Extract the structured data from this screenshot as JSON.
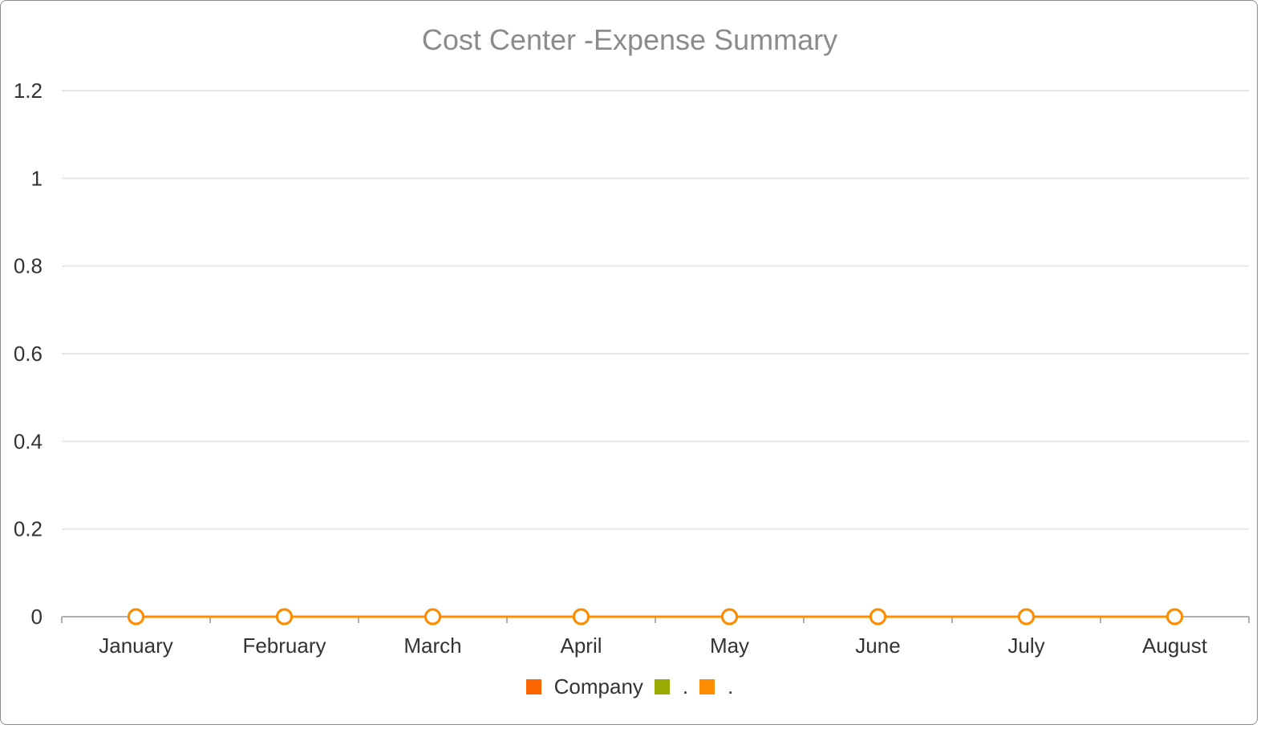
{
  "chart_data": {
    "type": "line",
    "title": "Cost Center -Expense Summary",
    "xlabel": "",
    "ylabel": "",
    "categories": [
      "January",
      "February",
      "March",
      "April",
      "May",
      "June",
      "July",
      "August"
    ],
    "series": [
      {
        "name": "Company",
        "color": "#ff6600",
        "values": [
          0,
          0,
          0,
          0,
          0,
          0,
          0,
          0
        ]
      },
      {
        "name": ".",
        "color": "#99aa00",
        "values": [
          0,
          0,
          0,
          0,
          0,
          0,
          0,
          0
        ]
      },
      {
        "name": ".",
        "color": "#ff8c00",
        "values": [
          0,
          0,
          0,
          0,
          0,
          0,
          0,
          0
        ]
      }
    ],
    "ylim": [
      0,
      1.2
    ],
    "yticks": [
      "0",
      "0.2",
      "0.4",
      "0.6",
      "0.8",
      "1",
      "1.2"
    ],
    "grid": true,
    "legend_position": "bottom-center",
    "colors": {
      "gridline": "#e6e6e6",
      "axis": "#b0b0b0",
      "tick_text": "#333333",
      "title_text": "#8b8b8b"
    }
  }
}
